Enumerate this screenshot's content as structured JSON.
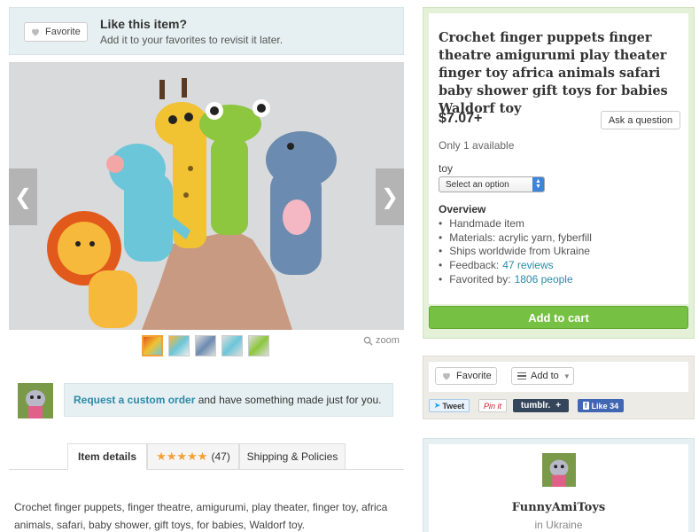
{
  "favorite_banner": {
    "button_label": "Favorite",
    "title": "Like this item?",
    "subtitle": "Add it to your favorites to revisit it later."
  },
  "gallery": {
    "zoom_label": "zoom",
    "thumbnail_count": 5
  },
  "custom_order": {
    "link_text": "Request a custom order",
    "rest_text": " and have something made just for you."
  },
  "tabs": {
    "details": "Item details",
    "reviews_count": "(47)",
    "shipping": "Shipping & Policies",
    "rating_stars": "★★★★★"
  },
  "description": "Crochet finger puppets, finger theatre, amigurumi, play theater, finger toy, africa animals, safari, baby shower, gift toys, for babies, Waldorf toy.",
  "listing": {
    "title": "Crochet finger puppets finger theatre amigurumi play theater finger toy africa animals safari baby shower gift toys for babies Waldorf toy",
    "price": "$7.07+",
    "ask_button": "Ask a question",
    "availability": "Only 1 available",
    "option_label": "toy",
    "option_selected": "Select an option",
    "overview_title": "Overview",
    "overview": {
      "handmade": "Handmade item",
      "materials": "Materials: acrylic yarn, fyberfill",
      "ships": "Ships worldwide from Ukraine",
      "feedback_label": "Feedback:",
      "feedback_link": "47 reviews",
      "favorited_label": "Favorited by:",
      "favorited_link": "1806 people"
    },
    "cart_button": "Add to cart"
  },
  "social": {
    "favorite": "Favorite",
    "add_to": "Add to",
    "tweet": "Tweet",
    "pinit": "Pin it",
    "tumblr": "tumblr.",
    "tumblr_plus": "+",
    "like": "Like 34"
  },
  "shop": {
    "name": "FunnyAmiToys",
    "location": "in Ukraine"
  },
  "colors": {
    "accent_green": "#76c043",
    "link_blue": "#2b8aa8",
    "star_orange": "#f4a034"
  }
}
